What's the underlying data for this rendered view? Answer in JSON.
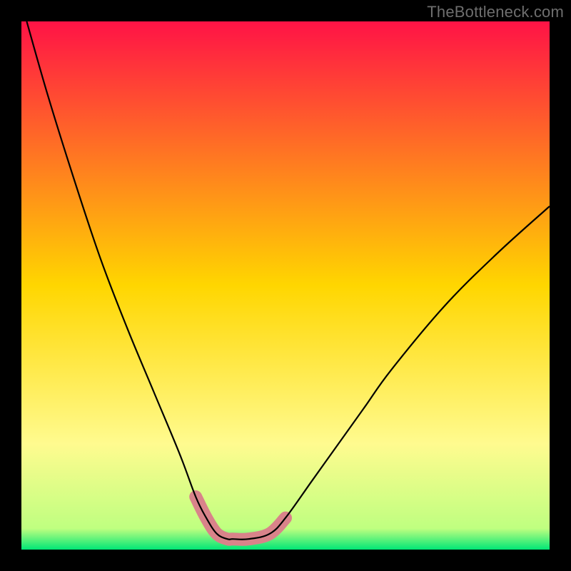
{
  "watermark": "TheBottleneck.com",
  "chart_data": {
    "type": "line",
    "title": "",
    "xlabel": "",
    "ylabel": "",
    "xlim": [
      0,
      100
    ],
    "ylim": [
      0,
      100
    ],
    "grid": false,
    "legend": false,
    "series": [
      {
        "name": "bottleneck-curve",
        "color": "#000000",
        "x": [
          1,
          5,
          10,
          15,
          20,
          25,
          30,
          33,
          35,
          37,
          39,
          40,
          43,
          47,
          50,
          55,
          60,
          65,
          70,
          80,
          90,
          100
        ],
        "y": [
          100,
          86,
          70,
          55,
          42,
          30,
          18,
          10,
          6,
          3,
          2,
          2,
          2,
          3,
          6,
          13,
          20,
          27,
          34,
          46,
          56,
          65
        ]
      }
    ],
    "highlight": {
      "name": "optimal-range",
      "color": "#d9838a",
      "x_range": [
        33,
        50
      ],
      "note": "thickened salmon segment near the curve minimum"
    },
    "background_gradient": {
      "stops": [
        {
          "t": 0.0,
          "color": "#ff1346"
        },
        {
          "t": 0.5,
          "color": "#ffd600"
        },
        {
          "t": 0.8,
          "color": "#fffb8f"
        },
        {
          "t": 0.96,
          "color": "#bfff80"
        },
        {
          "t": 1.0,
          "color": "#00e676"
        }
      ]
    }
  }
}
